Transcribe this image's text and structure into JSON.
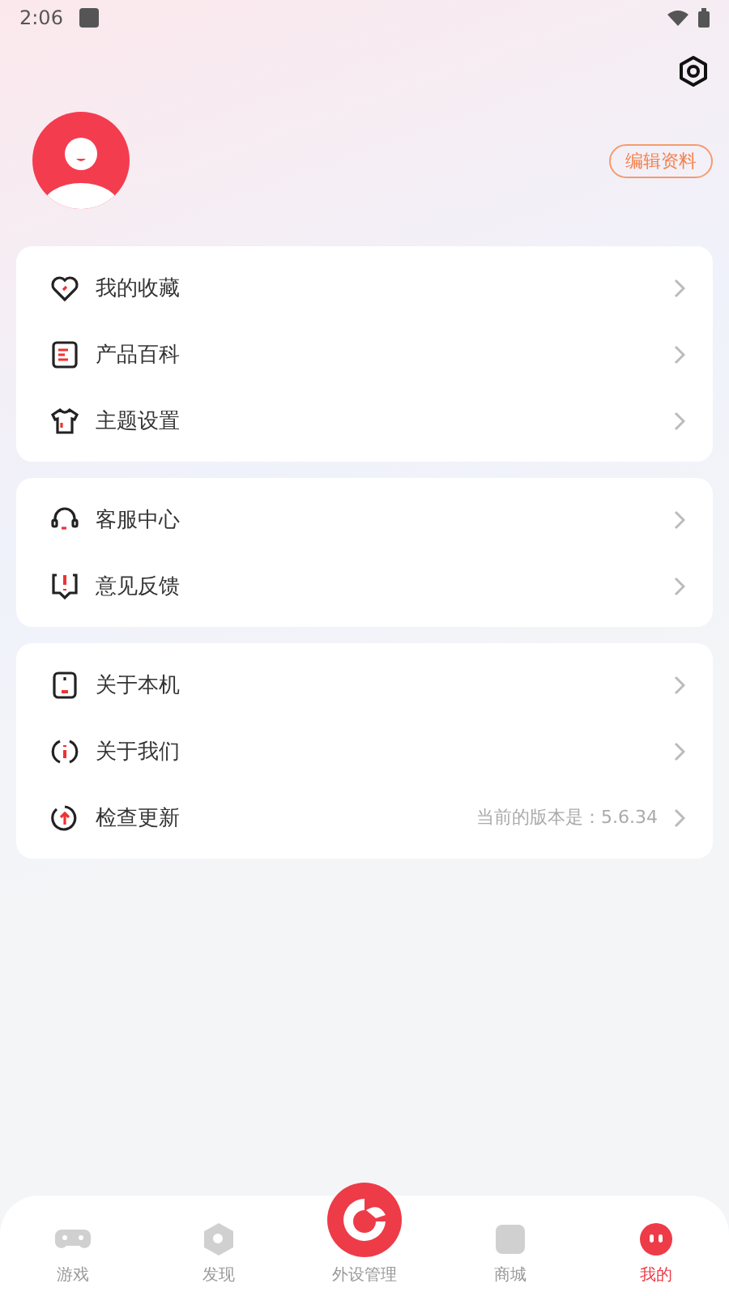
{
  "status_bar": {
    "time": "2:06"
  },
  "profile": {
    "edit_button": "编辑资料"
  },
  "groups": [
    {
      "items": [
        {
          "label": "我的收藏"
        },
        {
          "label": "产品百科"
        },
        {
          "label": "主题设置"
        }
      ]
    },
    {
      "items": [
        {
          "label": "客服中心"
        },
        {
          "label": "意见反馈"
        }
      ]
    },
    {
      "items": [
        {
          "label": "关于本机"
        },
        {
          "label": "关于我们"
        },
        {
          "label": "检查更新",
          "note": "当前的版本是：5.6.34"
        }
      ]
    }
  ],
  "nav": [
    {
      "label": "游戏",
      "kind": "tab",
      "selected": false
    },
    {
      "label": "发现",
      "kind": "tab",
      "selected": false
    },
    {
      "label": "外设管理",
      "kind": "center",
      "selected": false
    },
    {
      "label": "商城",
      "kind": "tab",
      "selected": false
    },
    {
      "label": "我的",
      "kind": "tab",
      "selected": true
    }
  ]
}
